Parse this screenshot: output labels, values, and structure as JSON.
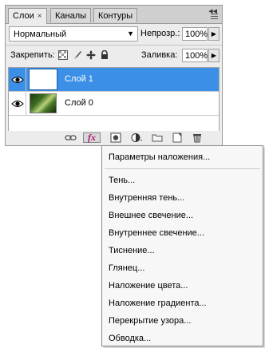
{
  "tabs": [
    {
      "label": "Слои",
      "active": true,
      "close": "×"
    },
    {
      "label": "Каналы",
      "active": false
    },
    {
      "label": "Контуры",
      "active": false
    }
  ],
  "blend_mode": "Нормальный",
  "opacity": {
    "label": "Непрозр.:",
    "value": "100%"
  },
  "lock": {
    "label": "Закрепить:"
  },
  "fill": {
    "label": "Заливка:",
    "value": "100%"
  },
  "layers": [
    {
      "name": "Слой 1",
      "selected": true,
      "thumbnail": "white"
    },
    {
      "name": "Слой 0",
      "selected": false,
      "thumbnail": "forest-photo"
    }
  ],
  "bottom_icons": [
    "link-icon",
    "fx-icon",
    "mask-icon",
    "adjustment-icon",
    "folder-icon",
    "new-layer-icon",
    "trash-icon"
  ],
  "fx_label": "fx",
  "menu": {
    "items": [
      "Параметры наложения...",
      "Тень...",
      "Внутренняя тень...",
      "Внешнее свечение...",
      "Внутреннее свечение...",
      "Тиснение...",
      "Глянец...",
      "Наложение цвета...",
      "Наложение градиента...",
      "Перекрытие узора...",
      "Обводка..."
    ]
  },
  "colors": {
    "selection": "#3b8fe6",
    "panel": "#ececec"
  }
}
